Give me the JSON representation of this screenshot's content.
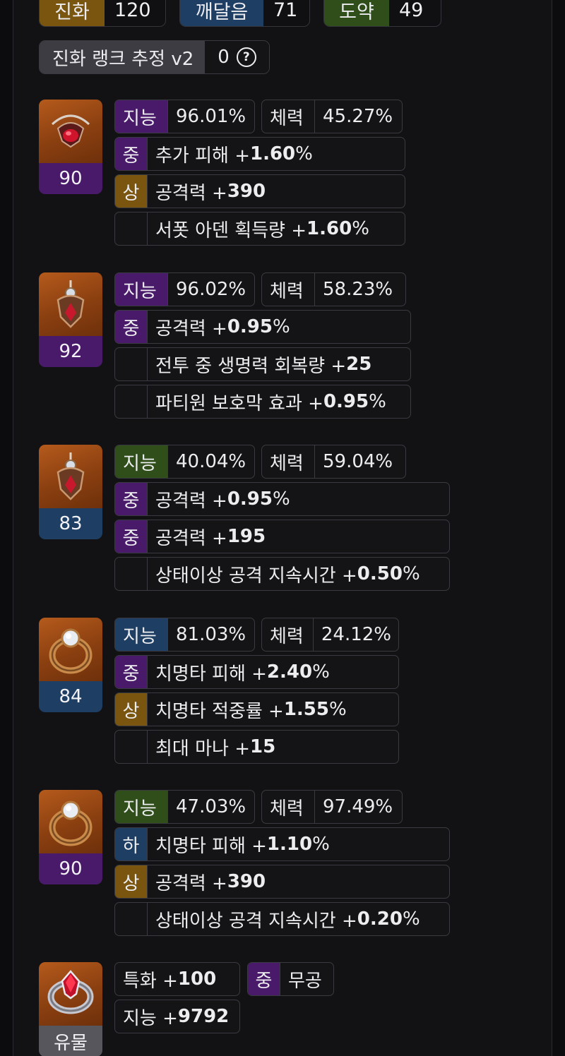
{
  "top_stats": [
    {
      "label": "진화",
      "value": "120",
      "color": "#7a5510"
    },
    {
      "label": "깨달음",
      "value": "71",
      "color": "#1e3f63"
    },
    {
      "label": "도약",
      "value": "49",
      "color": "#2f4e19"
    }
  ],
  "rank_estimate": {
    "label": "진화 랭크 추정 v2",
    "value": "0",
    "help_icon": "question-circle-icon"
  },
  "items": [
    {
      "level": "90",
      "level_color": "purple",
      "icon": "necklace-icon",
      "stats": [
        {
          "name": "지능",
          "value": "96.01%",
          "color": "purple"
        },
        {
          "name": "체력",
          "value": "45.27%"
        }
      ],
      "effects": [
        {
          "grade": "중",
          "grade_color": "purple",
          "text": "추가 피해 +",
          "num": "1.60",
          "suffix": "%"
        },
        {
          "grade": "상",
          "grade_color": "gold",
          "text": "공격력 +",
          "num": "390",
          "suffix": ""
        },
        {
          "grade": "",
          "grade_color": "none",
          "text": "서폿 아덴 획득량 +",
          "num": "1.60",
          "suffix": "%"
        }
      ]
    },
    {
      "level": "92",
      "level_color": "purple",
      "icon": "earring-icon",
      "stats": [
        {
          "name": "지능",
          "value": "96.02%",
          "color": "purple"
        },
        {
          "name": "체력",
          "value": "58.23%"
        }
      ],
      "effects": [
        {
          "grade": "중",
          "grade_color": "purple",
          "text": "공격력 +",
          "num": "0.95",
          "suffix": "%"
        },
        {
          "grade": "",
          "grade_color": "none",
          "text": "전투 중 생명력 회복량 +",
          "num": "25",
          "suffix": ""
        },
        {
          "grade": "",
          "grade_color": "none",
          "text": "파티원 보호막 효과 +",
          "num": "0.95",
          "suffix": "%"
        }
      ]
    },
    {
      "level": "83",
      "level_color": "blue",
      "icon": "earring-icon",
      "stats": [
        {
          "name": "지능",
          "value": "40.04%",
          "color": "green"
        },
        {
          "name": "체력",
          "value": "59.04%"
        }
      ],
      "effects": [
        {
          "grade": "중",
          "grade_color": "purple",
          "text": "공격력 +",
          "num": "0.95",
          "suffix": "%"
        },
        {
          "grade": "중",
          "grade_color": "purple",
          "text": "공격력 +",
          "num": "195",
          "suffix": ""
        },
        {
          "grade": "",
          "grade_color": "none",
          "text": "상태이상 공격 지속시간 +",
          "num": "0.50",
          "suffix": "%"
        }
      ]
    },
    {
      "level": "84",
      "level_color": "blue",
      "icon": "ring-icon",
      "stats": [
        {
          "name": "지능",
          "value": "81.03%",
          "color": "navy"
        },
        {
          "name": "체력",
          "value": "24.12%"
        }
      ],
      "effects": [
        {
          "grade": "중",
          "grade_color": "purple",
          "text": "치명타 피해 +",
          "num": "2.40",
          "suffix": "%"
        },
        {
          "grade": "상",
          "grade_color": "gold",
          "text": "치명타 적중률 +",
          "num": "1.55",
          "suffix": "%"
        },
        {
          "grade": "",
          "grade_color": "none",
          "text": "최대 마나 +",
          "num": "15",
          "suffix": ""
        }
      ]
    },
    {
      "level": "90",
      "level_color": "purple",
      "icon": "ring-icon",
      "stats": [
        {
          "name": "지능",
          "value": "47.03%",
          "color": "green"
        },
        {
          "name": "체력",
          "value": "97.49%"
        }
      ],
      "effects": [
        {
          "grade": "하",
          "grade_color": "navy",
          "text": "치명타 피해 +",
          "num": "1.10",
          "suffix": "%"
        },
        {
          "grade": "상",
          "grade_color": "gold",
          "text": "공격력 +",
          "num": "390",
          "suffix": ""
        },
        {
          "grade": "",
          "grade_color": "none",
          "text": "상태이상 공격 지속시간 +",
          "num": "0.20",
          "suffix": "%"
        }
      ]
    }
  ],
  "bracelet": {
    "level": "유물",
    "icon": "bracelet-icon",
    "spec": {
      "text": "특화 +",
      "num": "100"
    },
    "grade_tag": {
      "grade": "중",
      "text": "무공"
    },
    "int": {
      "text": "지능 +",
      "num": "9792"
    }
  },
  "colors": {
    "purple": "#4a1a6a",
    "gold": "#7a5510",
    "navy": "#1e3f63",
    "green": "#2f4e19",
    "orange_bg": "#b55a1c"
  }
}
